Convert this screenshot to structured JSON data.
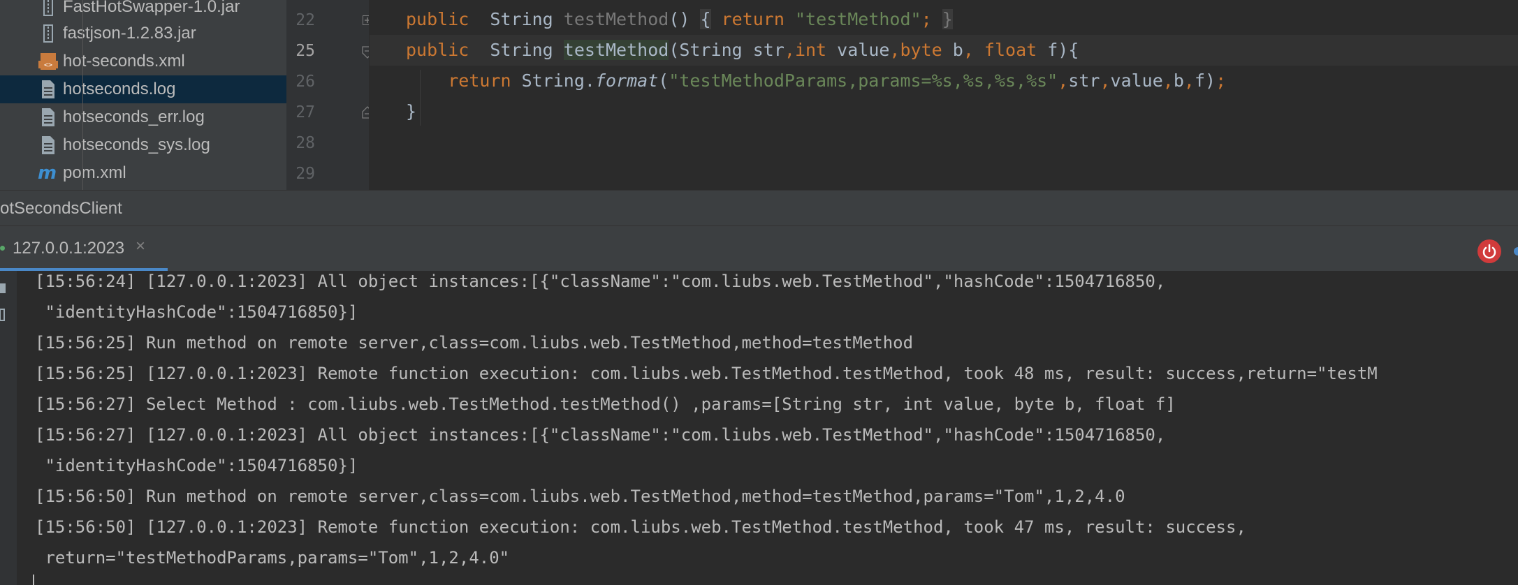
{
  "project_tree": {
    "items": [
      {
        "label": "FastHotSwapper-1.0.jar",
        "icon": "jar-icon",
        "selected": false
      },
      {
        "label": "fastjson-1.2.83.jar",
        "icon": "jar-icon",
        "selected": false
      },
      {
        "label": "hot-seconds.xml",
        "icon": "xml-file-icon",
        "selected": false
      },
      {
        "label": "hotseconds.log",
        "icon": "text-file-icon",
        "selected": true
      },
      {
        "label": "hotseconds_err.log",
        "icon": "text-file-icon",
        "selected": false
      },
      {
        "label": "hotseconds_sys.log",
        "icon": "text-file-icon",
        "selected": false
      },
      {
        "label": "pom.xml",
        "icon": "maven-icon",
        "selected": false
      }
    ]
  },
  "editor": {
    "line_numbers": [
      "22",
      "25",
      "26",
      "27",
      "28",
      "29"
    ],
    "current_line": "25",
    "lines": {
      "l22": {
        "kw": "public",
        "ty": "String",
        "mn": "testMethod",
        "p1": "() ",
        "b1": "{",
        "ret": "return",
        "str": "\"testMethod\"",
        "semi": ";",
        "b2": "}"
      },
      "l25": {
        "kw": "public",
        "ty": "String",
        "mn": "testMethod",
        "params_open": "(String str",
        "c1": ",",
        "kw_int": "int",
        "v1": " value",
        "c2": ",",
        "kw_byte": "byte",
        "v2": " b",
        "c3": ", ",
        "kw_float": "float",
        "v3": " f){"
      },
      "l26": {
        "ret": "return",
        "cls": " String.",
        "fmt": "format",
        "open": "(",
        "str": "\"testMethodParams,params=%s,%s,%s,%s\"",
        "c1": ",",
        "a1": "str",
        "c2": ",",
        "a2": "value",
        "c3": ",",
        "a3": "b",
        "c4": ",",
        "a4": "f",
        "close": ")",
        "semi": ";"
      },
      "l27": {
        "brace": "}"
      }
    }
  },
  "run_panel": {
    "title": "otSecondsClient",
    "tab_label": "127.0.0.1:2023",
    "tab_close": "×",
    "console_lines": [
      "[15:56:24] [127.0.0.1:2023] All object instances:[{\"className\":\"com.liubs.web.TestMethod\",\"hashCode\":1504716850,",
      " \"identityHashCode\":1504716850}]",
      "[15:56:25] Run method on remote server,class=com.liubs.web.TestMethod,method=testMethod",
      "[15:56:25] [127.0.0.1:2023] Remote function execution: com.liubs.web.TestMethod.testMethod, took 48 ms, result: success,return=\"testM",
      "[15:56:27] Select Method : com.liubs.web.TestMethod.testMethod() ,params=[String str, int value, byte b, float f]",
      "[15:56:27] [127.0.0.1:2023] All object instances:[{\"className\":\"com.liubs.web.TestMethod\",\"hashCode\":1504716850,",
      " \"identityHashCode\":1504716850}]",
      "[15:56:50] Run method on remote server,class=com.liubs.web.TestMethod,method=testMethod,params=\"Tom\",1,2,4.0",
      "[15:56:50] [127.0.0.1:2023] Remote function execution: com.liubs.web.TestMethod.testMethod, took 47 ms, result: success,",
      " return=\"testMethodParams,params=\"Tom\",1,2,4.0\""
    ]
  },
  "colors": {
    "keyword": "#cc7832",
    "string": "#6a8759",
    "method": "#ffc66d",
    "selection": "#0d293e",
    "stop": "#d13b3b"
  }
}
